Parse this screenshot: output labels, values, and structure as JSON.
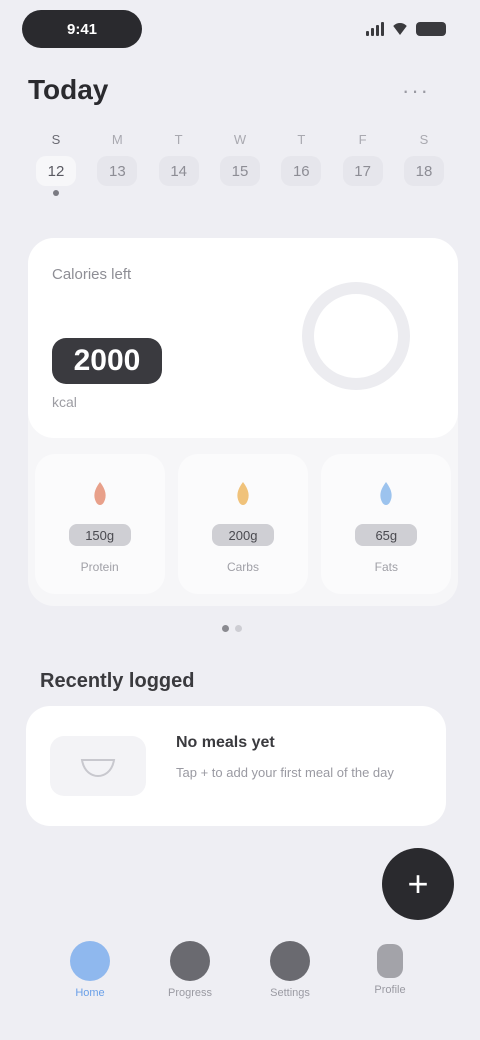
{
  "status_bar": {
    "time": "9:41"
  },
  "header": {
    "title": "Today",
    "more_label": "···"
  },
  "week": {
    "days": [
      {
        "name": "S",
        "num": "12",
        "active": true
      },
      {
        "name": "M",
        "num": "13",
        "active": false
      },
      {
        "name": "T",
        "num": "14",
        "active": false
      },
      {
        "name": "W",
        "num": "15",
        "active": false
      },
      {
        "name": "T",
        "num": "16",
        "active": false
      },
      {
        "name": "F",
        "num": "17",
        "active": false
      },
      {
        "name": "S",
        "num": "18",
        "active": false
      }
    ]
  },
  "summary": {
    "calories_label": "Calories left",
    "calories_value": "2000",
    "calories_sub": "kcal",
    "macros": [
      {
        "value": "150g",
        "name": "Protein",
        "color": "#e8a08a"
      },
      {
        "value": "200g",
        "name": "Carbs",
        "color": "#f0c27a"
      },
      {
        "value": "65g",
        "name": "Fats",
        "color": "#9cc3ee"
      }
    ]
  },
  "section": {
    "title": "Recently logged"
  },
  "recent": {
    "title": "No meals yet",
    "desc": "Tap + to add your first meal of the day"
  },
  "fab": {
    "label": "+"
  },
  "tabs": [
    {
      "label": "Home",
      "active": true
    },
    {
      "label": "Progress",
      "active": false
    },
    {
      "label": "Settings",
      "active": false
    },
    {
      "label": "Profile",
      "active": false
    }
  ],
  "colors": {
    "accent": "#6aa0e8",
    "dark": "#2a2a2e",
    "background": "#eeeef3"
  }
}
